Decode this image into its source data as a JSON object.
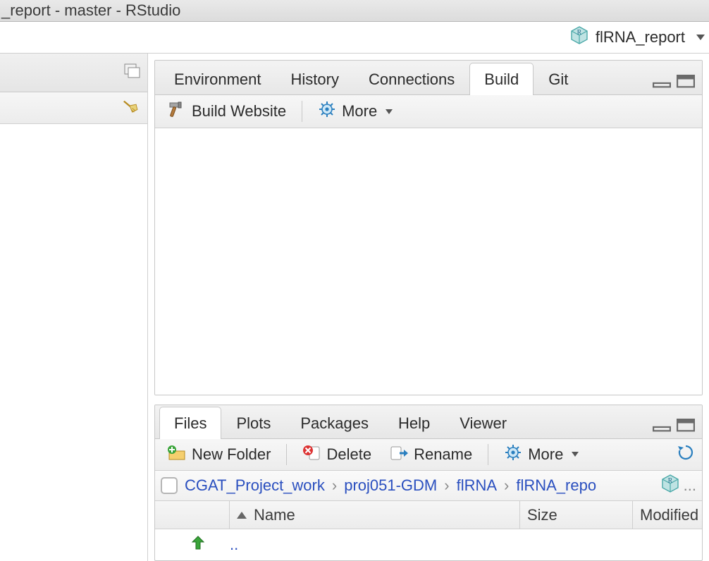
{
  "window_title": "_report - master - RStudio",
  "project": {
    "name": "flRNA_report"
  },
  "top_pane": {
    "tabs": [
      "Environment",
      "History",
      "Connections",
      "Build",
      "Git"
    ],
    "active": "Build",
    "build_toolbar": {
      "build_website": "Build Website",
      "more": "More"
    }
  },
  "bottom_pane": {
    "tabs": [
      "Files",
      "Plots",
      "Packages",
      "Help",
      "Viewer"
    ],
    "active": "Files",
    "file_toolbar": {
      "new_folder": "New Folder",
      "delete": "Delete",
      "rename": "Rename",
      "more": "More"
    },
    "breadcrumb": [
      "CGAT_Project_work",
      "proj051-GDM",
      "flRNA",
      "flRNA_repo"
    ],
    "breadcrumb_overflow": "...",
    "columns": {
      "name": "Name",
      "size": "Size",
      "modified": "Modified"
    },
    "rows": [
      {
        "name": "..",
        "type": "up"
      }
    ]
  }
}
